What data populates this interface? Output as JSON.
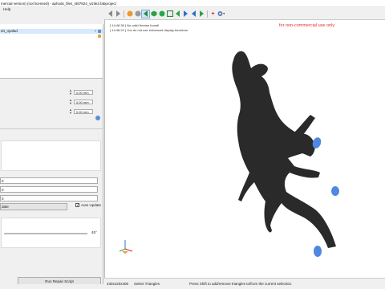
{
  "window": {
    "title": "mercial version) (not licensed) - aphods_files_l487824_vizile3.fabproject"
  },
  "menu": {
    "items": [
      "Help"
    ]
  },
  "toolbar": {
    "buttons": [
      {
        "icon": "arrow-left-gray-icon"
      },
      {
        "icon": "arrow-right-gray-icon"
      },
      {
        "icon": "sphere-orange-icon"
      },
      {
        "icon": "sphere-gray-icon"
      },
      {
        "icon": "select-tool-icon",
        "active": true
      },
      {
        "icon": "hexagon-green-icon"
      },
      {
        "icon": "circle-green-icon"
      },
      {
        "icon": "frame-green-icon"
      },
      {
        "icon": "arrow-left-green-icon"
      },
      {
        "icon": "arrow-right-blue-icon"
      },
      {
        "icon": "arrow-left-blue-icon"
      },
      {
        "icon": "arrow-right-green-icon"
      },
      {
        "icon": "add-red-icon"
      },
      {
        "icon": "gear-dropdown-icon"
      }
    ]
  },
  "tree": {
    "rows": [
      {
        "label": "",
        "selected": false
      },
      {
        "label": "d4_ojutlad",
        "selected": true
      },
      {
        "label": "",
        "selected": false
      }
    ]
  },
  "properties": {
    "fields": [
      {
        "value": "0.00 mm"
      },
      {
        "value": "0.00 mm"
      },
      {
        "value": "0.00 mm"
      }
    ]
  },
  "tool_panel": {
    "inputs": [
      {
        "value": "0"
      },
      {
        "value": "0"
      },
      {
        "value": "0"
      }
    ],
    "update_button": "date",
    "auto_update": {
      "label": "Auto Update",
      "checked": true
    },
    "slider_value": "45°",
    "run_button": "Run Repair Script"
  },
  "viewport": {
    "log": [
      "[ 14:46:36 ] No valid license found!",
      "[ 14:46:22 ] You do not use enhanced display functions"
    ],
    "watermark": "for non-commercial use only"
  },
  "status": {
    "dimensions": "430x420x405",
    "mode": "Select Triangles",
    "hint": "Press Shift to add/remove triangles to/from the current selection."
  },
  "colors": {
    "accent": "#3a78c2",
    "model": "#2a2a2a",
    "selected_faces": "#4f88e0",
    "watermark": "#e03030"
  }
}
